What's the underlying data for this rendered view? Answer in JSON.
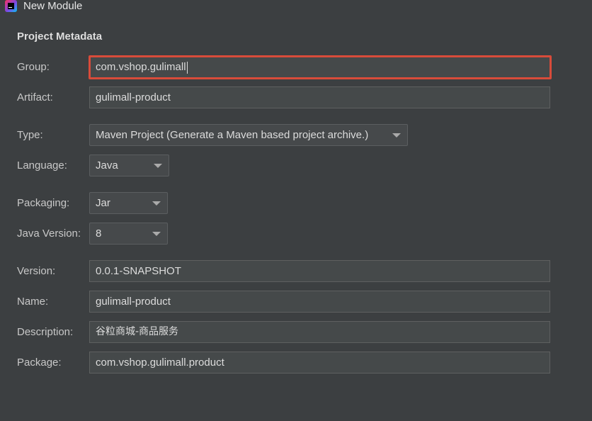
{
  "window": {
    "title": "New Module"
  },
  "section": {
    "title": "Project Metadata"
  },
  "group": {
    "label": "Group:",
    "value": "com.vshop.gulimall"
  },
  "artifact": {
    "label": "Artifact:",
    "value": "gulimall-product"
  },
  "type": {
    "label": "Type:",
    "value": "Maven Project (Generate a Maven based project archive.)"
  },
  "language": {
    "label": "Language:",
    "value": "Java"
  },
  "packaging": {
    "label": "Packaging:",
    "value": "Jar"
  },
  "java_version": {
    "label": "Java Version:",
    "value": "8"
  },
  "version": {
    "label": "Version:",
    "value": "0.0.1-SNAPSHOT"
  },
  "name": {
    "label": "Name:",
    "value": "gulimall-product"
  },
  "description": {
    "label": "Description:",
    "value": "谷粒商城-商品服务"
  },
  "package": {
    "label": "Package:",
    "value": "com.vshop.gulimall.product"
  },
  "icons": {
    "app": "intellij-idea-icon",
    "dropdown": "chevron-down-icon"
  },
  "colors": {
    "background": "#3c3f41",
    "focus_border": "#d84b3a",
    "field_bg": "#45494a"
  }
}
